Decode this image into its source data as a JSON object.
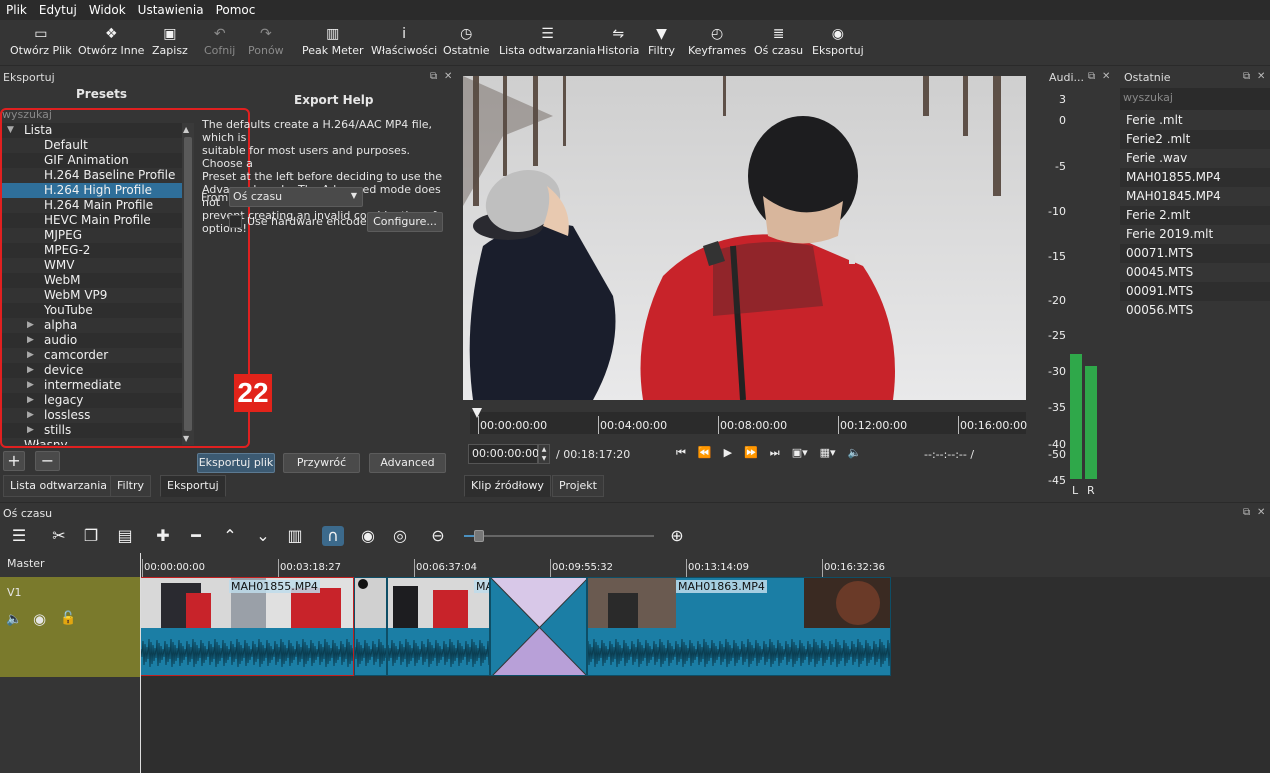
{
  "menu": [
    "Plik",
    "Edytuj",
    "Widok",
    "Ustawienia",
    "Pomoc"
  ],
  "toolbar": [
    {
      "label": "Otwórz Plik",
      "icon": "folder-icon",
      "glyph": "▭",
      "enabled": true
    },
    {
      "label": "Otwórz Inne",
      "icon": "open-other-icon",
      "glyph": "❖",
      "enabled": true
    },
    {
      "label": "Zapisz",
      "icon": "save-icon",
      "glyph": "▣",
      "enabled": true
    },
    {
      "label": "Cofnij",
      "icon": "undo-icon",
      "glyph": "↶",
      "enabled": false
    },
    {
      "label": "Ponów",
      "icon": "redo-icon",
      "glyph": "↷",
      "enabled": false
    },
    {
      "label": "Peak Meter",
      "icon": "peak-meter-icon",
      "glyph": "▥",
      "enabled": true
    },
    {
      "label": "Właściwości",
      "icon": "info-icon",
      "glyph": "i",
      "enabled": true
    },
    {
      "label": "Ostatnie",
      "icon": "clock-icon",
      "glyph": "◷",
      "enabled": true
    },
    {
      "label": "Lista odtwarzania",
      "icon": "list-icon",
      "glyph": "☰",
      "enabled": true
    },
    {
      "label": "Historia",
      "icon": "history-icon",
      "glyph": "⇋",
      "enabled": true
    },
    {
      "label": "Filtry",
      "icon": "filter-icon",
      "glyph": "▼",
      "enabled": true
    },
    {
      "label": "Keyframes",
      "icon": "stopwatch-icon",
      "glyph": "◴",
      "enabled": true
    },
    {
      "label": "Oś czasu",
      "icon": "timeline-icon",
      "glyph": "≣",
      "enabled": true
    },
    {
      "label": "Eksportuj",
      "icon": "export-icon",
      "glyph": "◉",
      "enabled": true
    }
  ],
  "export_panel": {
    "title": "Eksportuj",
    "presets_header": "Presets",
    "search_placeholder": "wyszukaj",
    "tree": [
      {
        "label": "Lista",
        "level": 0,
        "twisty": "▼"
      },
      {
        "label": "Default",
        "level": 1
      },
      {
        "label": "GIF Animation",
        "level": 1
      },
      {
        "label": "H.264 Baseline Profile",
        "level": 1
      },
      {
        "label": "H.264 High Profile",
        "level": 1,
        "selected": true
      },
      {
        "label": "H.264 Main Profile",
        "level": 1
      },
      {
        "label": "HEVC Main Profile",
        "level": 1
      },
      {
        "label": "MJPEG",
        "level": 1
      },
      {
        "label": "MPEG-2",
        "level": 1
      },
      {
        "label": "WMV",
        "level": 1
      },
      {
        "label": "WebM",
        "level": 1
      },
      {
        "label": "WebM VP9",
        "level": 1
      },
      {
        "label": "YouTube",
        "level": 1
      },
      {
        "label": "alpha",
        "level": 1,
        "twisty": "▶"
      },
      {
        "label": "audio",
        "level": 1,
        "twisty": "▶"
      },
      {
        "label": "camcorder",
        "level": 1,
        "twisty": "▶"
      },
      {
        "label": "device",
        "level": 1,
        "twisty": "▶"
      },
      {
        "label": "intermediate",
        "level": 1,
        "twisty": "▶"
      },
      {
        "label": "legacy",
        "level": 1,
        "twisty": "▶"
      },
      {
        "label": "lossless",
        "level": 1,
        "twisty": "▶"
      },
      {
        "label": "stills",
        "level": 1,
        "twisty": "▶"
      },
      {
        "label": "Własny",
        "level": 0
      }
    ],
    "help_title": "Export Help",
    "help_text": [
      "The defaults create a H.264/AAC MP4 file, which is",
      "suitable for most users and purposes. Choose a",
      "Preset at the left before deciding to use the",
      "Advanced mode. The Advanced mode does not",
      "prevent creating an invalid combination of options!"
    ],
    "from_label": "From",
    "from_value": "Oś czasu",
    "hw_encoder_label": "Use hardware encoder",
    "configure_label": "Configure...",
    "export_file_label": "Eksportuj plik",
    "reset_label": "Przywróć",
    "advanced_label": "Advanced",
    "add_label": "+",
    "remove_label": "−"
  },
  "badge": "22",
  "left_tabs": [
    "Lista odtwarzania",
    "Filtry",
    "Eksportuj"
  ],
  "player": {
    "ruler_labels": [
      "00:00:00:00",
      "00:04:00:00",
      "00:08:00:00",
      "00:12:00:00",
      "00:16:00:00"
    ],
    "timecode": "00:00:00:00",
    "duration": "/ 00:18:17:20",
    "end_tc": "--:--:--:-- /",
    "tabs": [
      "Klip źródłowy",
      "Projekt"
    ]
  },
  "audio_meter": {
    "title": "Audi...",
    "scale": [
      "3",
      "0",
      "-5",
      "-10",
      "-15",
      "-20",
      "-25",
      "-30",
      "-35",
      "-40",
      "-45",
      "-50"
    ],
    "left_label": "L",
    "right_label": "R",
    "levels": {
      "L": 0.82,
      "R": 0.74
    },
    "color": "#2fa84a"
  },
  "recent": {
    "title": "Ostatnie",
    "search_placeholder": "wyszukaj",
    "items": [
      "Ferie .mlt",
      "Ferie2 .mlt",
      "Ferie .wav",
      "MAH01855.MP4",
      "MAH01845.MP4",
      "Ferie 2.mlt",
      "Ferie 2019.mlt",
      "00071.MTS",
      "00045.MTS",
      "00091.MTS",
      "00056.MTS"
    ]
  },
  "timeline": {
    "title": "Oś czasu",
    "master_label": "Master",
    "track_name": "V1",
    "ruler_labels": [
      "00:00:00:00",
      "00:03:18:27",
      "00:06:37:04",
      "00:09:55:32",
      "00:13:14:09",
      "00:16:32:36"
    ],
    "clips": [
      {
        "name": "MAH01855.MP4"
      },
      {
        "name": ""
      },
      {
        "name": "MA"
      },
      {
        "name": ""
      },
      {
        "name": "MAH01863.MP4"
      }
    ],
    "track_color": "#7a7a2c",
    "clip_color": "#1b7ea5"
  }
}
